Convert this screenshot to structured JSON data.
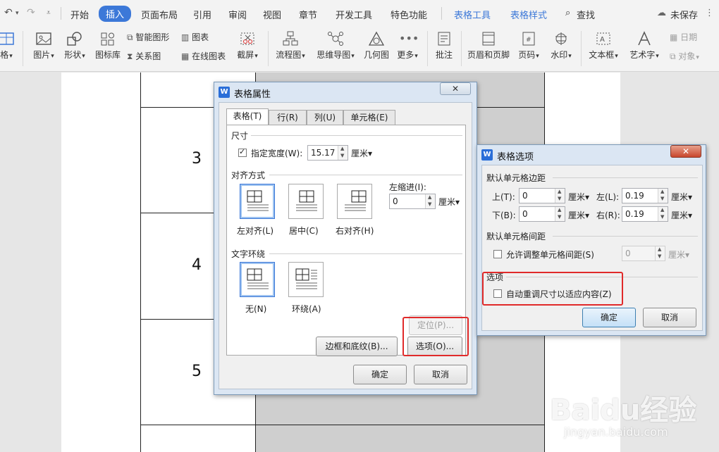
{
  "menubar": {
    "items": [
      "开始",
      "插入",
      "页面布局",
      "引用",
      "审阅",
      "视图",
      "章节",
      "开发工具",
      "特色功能",
      "表格工具",
      "表格样式"
    ],
    "search": "查找",
    "unsaved": "未保存"
  },
  "ribbon": {
    "table": "格",
    "picture": "图片",
    "shape": "形状",
    "icon_lib": "图标库",
    "smart_art": "智能图形",
    "relation": "关系图",
    "chart": "图表",
    "online_chart": "在线图表",
    "screenshot": "截屏",
    "flowchart": "流程图",
    "mindmap": "思维导图",
    "geometry": "几何图",
    "more": "更多",
    "comment": "批注",
    "header_footer": "页眉和页脚",
    "page_num": "页码",
    "watermark": "水印",
    "textbox": "文本框",
    "art_text": "艺术字",
    "date": "日期",
    "object": "对象"
  },
  "document": {
    "cells": [
      "3",
      "4",
      "5"
    ]
  },
  "table_props": {
    "title": "表格属性",
    "tabs": [
      "表格(T)",
      "行(R)",
      "列(U)",
      "单元格(E)"
    ],
    "size_label": "尺寸",
    "specify_width": "指定宽度(W):",
    "width_value": "15.17",
    "width_unit": "厘米▾",
    "align_label": "对齐方式",
    "align_left": "左对齐(L)",
    "align_center": "居中(C)",
    "align_right": "右对齐(H)",
    "left_indent": "左缩进(I):",
    "indent_value": "0",
    "indent_unit": "厘米▾",
    "wrap_label": "文字环绕",
    "wrap_none": "无(N)",
    "wrap_around": "环绕(A)",
    "position_btn": "定位(P)...",
    "border_btn": "边框和底纹(B)...",
    "options_btn": "选项(O)...",
    "ok": "确定",
    "cancel": "取消"
  },
  "table_options": {
    "title": "表格选项",
    "default_margins": "默认单元格边距",
    "top": "上(T):",
    "top_value": "0",
    "bottom": "下(B):",
    "bottom_value": "0",
    "left": "左(L):",
    "left_value": "0.19",
    "right": "右(R):",
    "right_value": "0.19",
    "unit": "厘米▾",
    "default_spacing": "默认单元格间距",
    "allow_spacing": "允许调整单元格间距(S)",
    "spacing_value": "0",
    "options_label": "选项",
    "auto_resize": "自动重调尺寸以适应内容(Z)",
    "ok": "确定",
    "cancel": "取消"
  },
  "watermark": {
    "brand": "Baidu经验",
    "url": "jingyan.baidu.com"
  },
  "colors": {
    "accent": "#3c78d8",
    "highlight": "#e02a2a"
  }
}
